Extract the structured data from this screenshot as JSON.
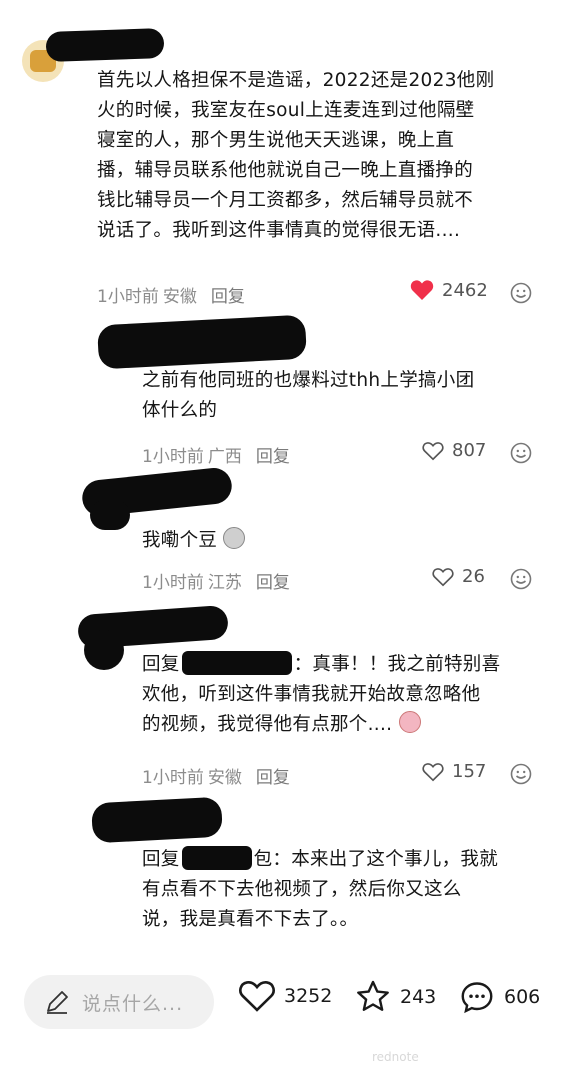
{
  "comments": [
    {
      "lines": [
        "首先以人格担保不是造谣，2022还是2023他刚",
        "火的时候，我室友在soul上连麦连到过他隔壁",
        "寝室的人，那个男生说他天天逃课，晚上直",
        "播，辅导员联系他他就说自己一晚上直播挣的",
        "钱比辅导员一个月工资都多，然后辅导员就不",
        "说话了。我听到这件事情真的觉得很无语...."
      ],
      "time": "1小时前",
      "location": "安徽",
      "reply_label": "回复",
      "likes": "2462",
      "liked": true
    },
    {
      "lines": [
        "之前有他同班的也爆料过thh上学搞小团",
        "体什么的"
      ],
      "time": "1小时前",
      "location": "广西",
      "reply_label": "回复",
      "likes": "807",
      "liked": false
    },
    {
      "lines": [
        "我嘞个豆"
      ],
      "time": "1小时前",
      "location": "江苏",
      "reply_label": "回复",
      "likes": "26",
      "liked": false
    },
    {
      "lines": [
        "回复",
        "：真事！！我之前特别喜",
        "欢他，听到这件事情我就开始故意忽略他",
        "的视频，我觉得他有点那个...."
      ],
      "time": "1小时前",
      "location": "安徽",
      "reply_label": "回复",
      "likes": "157",
      "liked": false
    },
    {
      "lines": [
        "回复",
        "包：本来出了这个事儿，我就",
        "有点看不下去他视频了，然后你又这么",
        "说，我是真看不下去了。。"
      ]
    }
  ],
  "bottom_bar": {
    "input_placeholder": "说点什么...",
    "like_count": "3252",
    "star_count": "243",
    "comment_count": "606"
  },
  "colors": {
    "liked_heart": "#f0304a",
    "meta_gray": "#8c8c8c"
  },
  "watermark": "rednote"
}
